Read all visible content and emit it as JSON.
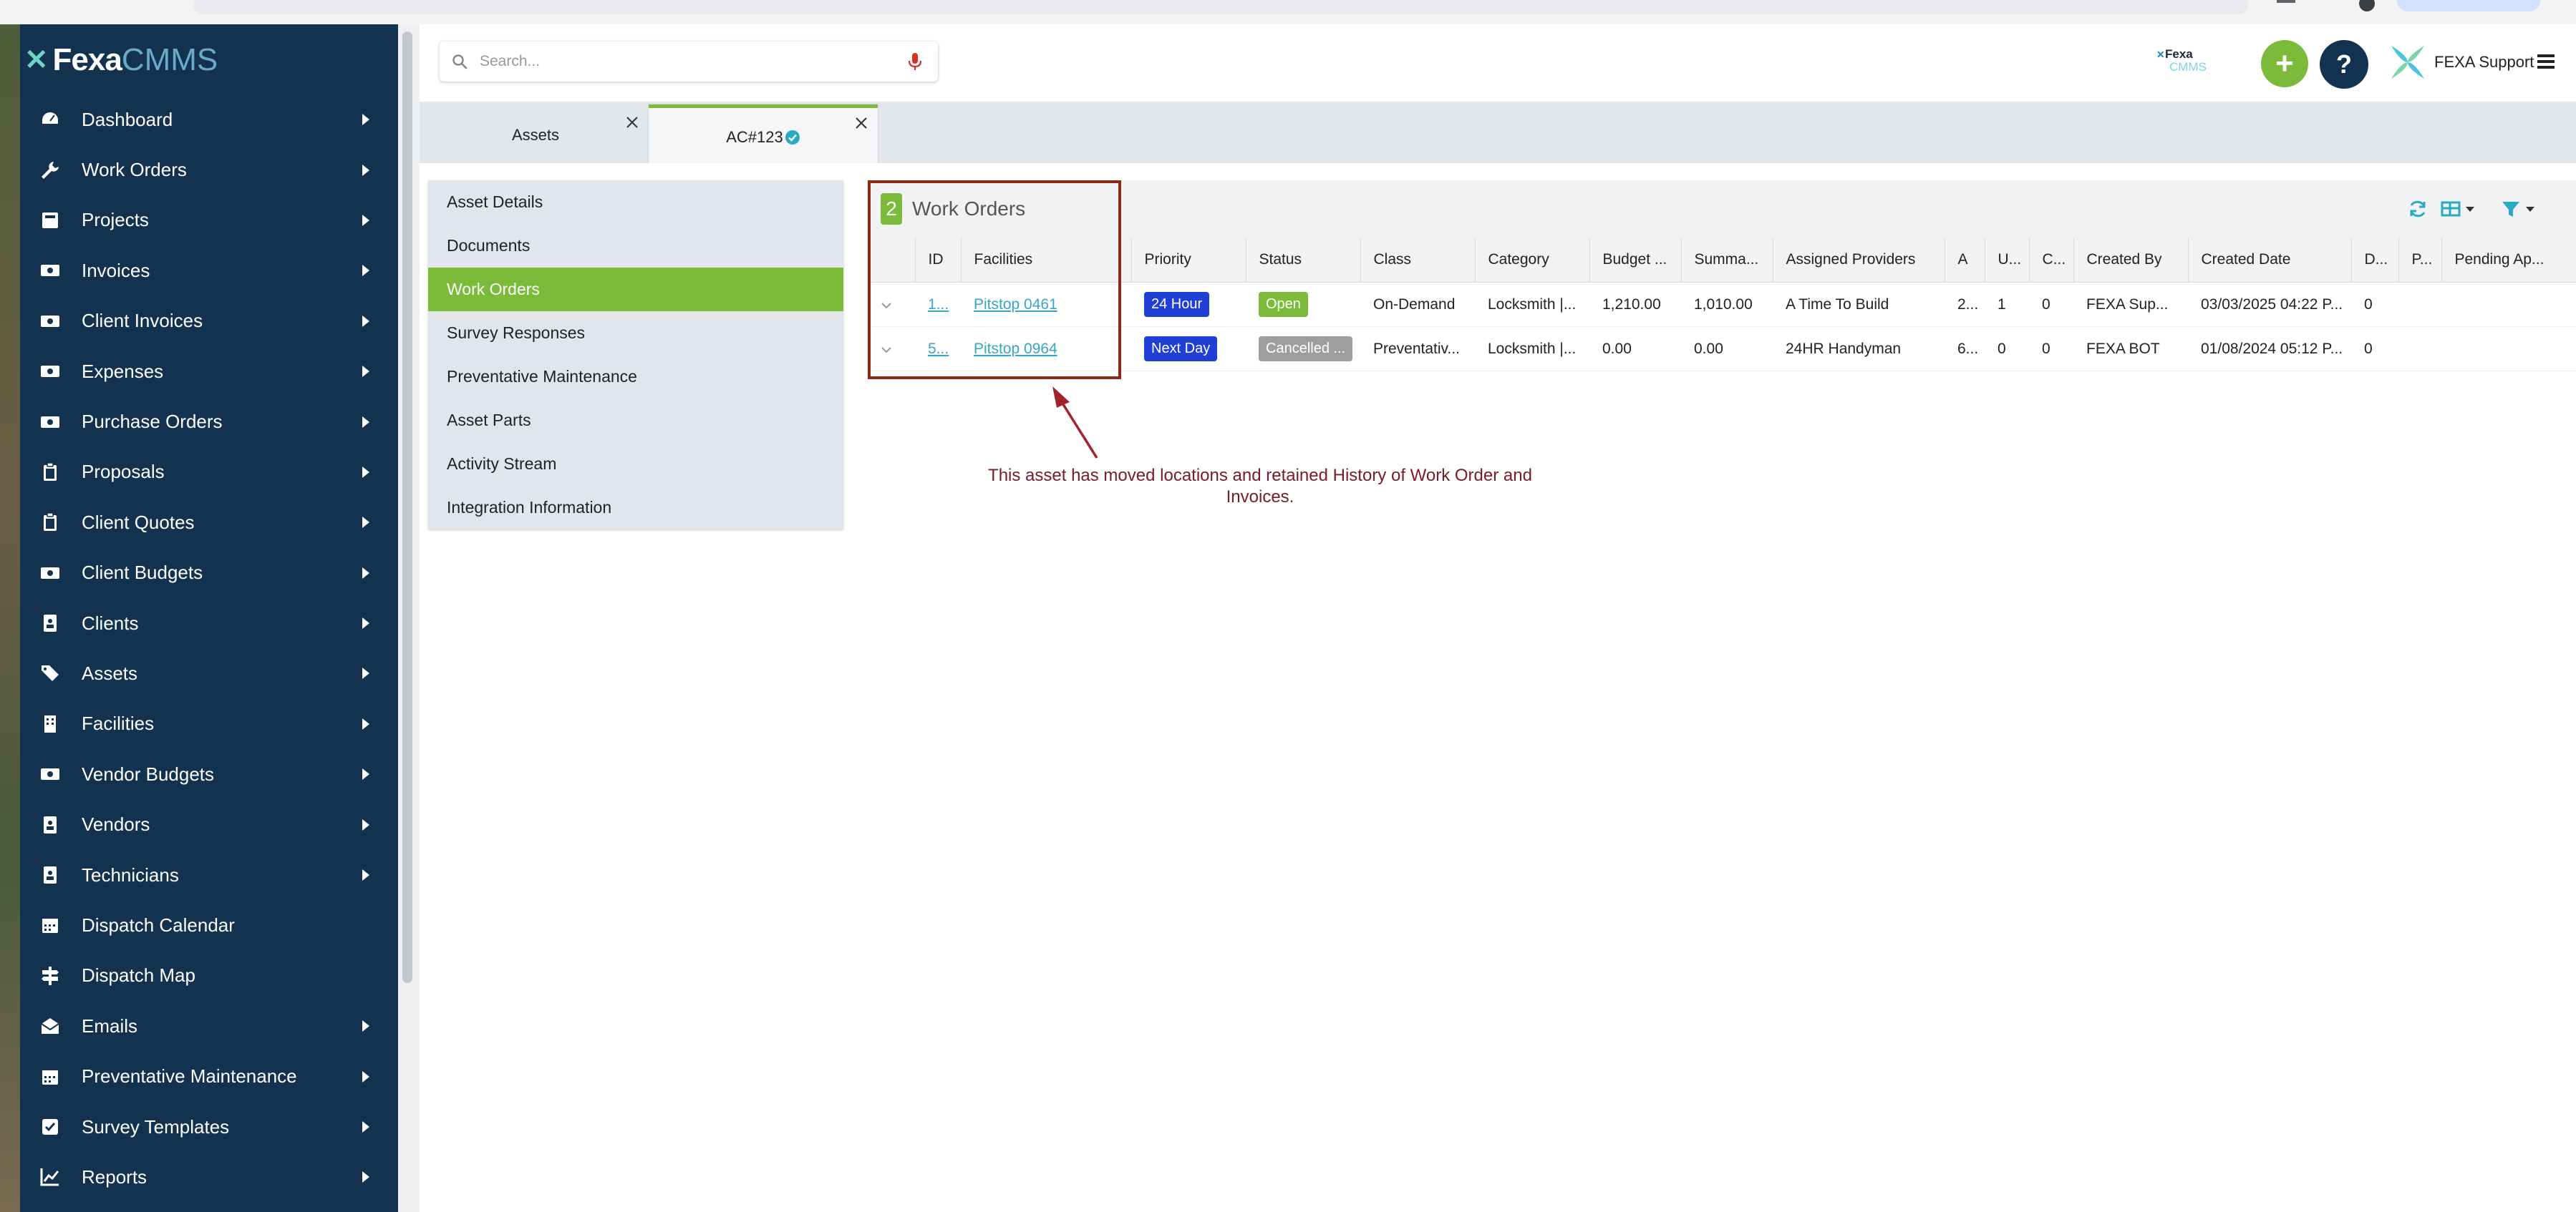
{
  "app": {
    "logo_brand": "Fexa",
    "logo_product": "CMMS"
  },
  "sidebar": {
    "items": [
      {
        "label": "Dashboard",
        "icon": "gauge-icon",
        "has_submenu": true
      },
      {
        "label": "Work Orders",
        "icon": "wrench-icon",
        "has_submenu": true
      },
      {
        "label": "Projects",
        "icon": "project-icon",
        "has_submenu": true
      },
      {
        "label": "Invoices",
        "icon": "money-icon",
        "has_submenu": true
      },
      {
        "label": "Client Invoices",
        "icon": "money-icon",
        "has_submenu": true
      },
      {
        "label": "Expenses",
        "icon": "money-icon",
        "has_submenu": true
      },
      {
        "label": "Purchase Orders",
        "icon": "money-icon",
        "has_submenu": true
      },
      {
        "label": "Proposals",
        "icon": "clipboard-icon",
        "has_submenu": true
      },
      {
        "label": "Client Quotes",
        "icon": "clipboard-icon",
        "has_submenu": true
      },
      {
        "label": "Client Budgets",
        "icon": "money-icon",
        "has_submenu": true
      },
      {
        "label": "Clients",
        "icon": "id-badge-icon",
        "has_submenu": true
      },
      {
        "label": "Assets",
        "icon": "tags-icon",
        "has_submenu": true
      },
      {
        "label": "Facilities",
        "icon": "building-icon",
        "has_submenu": true
      },
      {
        "label": "Vendor Budgets",
        "icon": "money-icon",
        "has_submenu": true
      },
      {
        "label": "Vendors",
        "icon": "id-badge-icon",
        "has_submenu": true
      },
      {
        "label": "Technicians",
        "icon": "id-badge-icon",
        "has_submenu": true
      },
      {
        "label": "Dispatch Calendar",
        "icon": "calendar-icon",
        "has_submenu": false
      },
      {
        "label": "Dispatch Map",
        "icon": "signpost-icon",
        "has_submenu": false
      },
      {
        "label": "Emails",
        "icon": "envelope-open-icon",
        "has_submenu": true
      },
      {
        "label": "Preventative Maintenance",
        "icon": "calendar-icon",
        "has_submenu": true
      },
      {
        "label": "Survey Templates",
        "icon": "checkbox-icon",
        "has_submenu": true
      },
      {
        "label": "Reports",
        "icon": "line-chart-icon",
        "has_submenu": true
      }
    ]
  },
  "header": {
    "search_placeholder": "Search...",
    "brand_small_fexa": "Fexa",
    "brand_small_cmms": "CMMS",
    "add_label": "+",
    "help_label": "?",
    "user_name": "FEXA Support"
  },
  "tabs": [
    {
      "label": "Assets",
      "active": false
    },
    {
      "label": "AC#123",
      "active": true
    }
  ],
  "asset_menu": {
    "items": [
      {
        "label": "Asset Details",
        "active": false
      },
      {
        "label": "Documents",
        "active": false
      },
      {
        "label": "Work Orders",
        "active": true
      },
      {
        "label": "Survey Responses",
        "active": false
      },
      {
        "label": "Preventative Maintenance",
        "active": false
      },
      {
        "label": "Asset Parts",
        "active": false
      },
      {
        "label": "Activity Stream",
        "active": false
      },
      {
        "label": "Integration Information",
        "active": false
      }
    ]
  },
  "work_orders": {
    "count": "2",
    "title": "Work Orders",
    "columns": [
      "",
      "ID",
      "Facilities",
      "Priority",
      "Status",
      "Class",
      "Category",
      "Budget ...",
      "Summa...",
      "Assigned Providers",
      "A",
      "U...",
      "C...",
      "Created By",
      "Created Date",
      "D...",
      "P...",
      "Pending Ap..."
    ],
    "rows": [
      {
        "id": "1...",
        "facility": "Pitstop 0461",
        "priority": "24 Hour",
        "priority_color": "#1f3fd6",
        "status": "Open",
        "status_color": "#7cbb3a",
        "class": "On-Demand",
        "category": "Locksmith |...",
        "budget": "1,210.00",
        "summary": "1,010.00",
        "providers": "A Time To Build",
        "a": "2...",
        "u": "1",
        "c": "0",
        "created_by": "FEXA Sup...",
        "created_date": "03/03/2025 04:22 P...",
        "d": "0",
        "p": "",
        "pending": ""
      },
      {
        "id": "5...",
        "facility": "Pitstop 0964",
        "priority": "Next Day",
        "priority_color": "#1f3fd6",
        "status": "Cancelled ...",
        "status_color": "#9e9e9e",
        "class": "Preventativ...",
        "category": "Locksmith |...",
        "budget": "0.00",
        "summary": "0.00",
        "providers": "24HR Handyman",
        "a": "6...",
        "u": "0",
        "c": "0",
        "created_by": "FEXA BOT",
        "created_date": "01/08/2024 05:12 P...",
        "d": "0",
        "p": "",
        "pending": ""
      }
    ]
  },
  "annotation": {
    "text": "This asset has moved locations and retained History of Work Order and Invoices."
  }
}
